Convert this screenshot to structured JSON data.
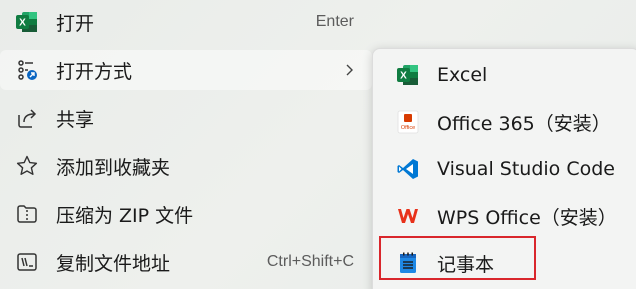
{
  "context_menu": {
    "items": [
      {
        "label": "打开",
        "shortcut": "Enter",
        "icon": "excel-icon"
      },
      {
        "label": "打开方式",
        "icon": "open-with-icon",
        "has_submenu": true
      },
      {
        "label": "共享",
        "icon": "share-icon"
      },
      {
        "label": "添加到收藏夹",
        "icon": "star-icon"
      },
      {
        "label": "压缩为 ZIP 文件",
        "icon": "zip-icon"
      },
      {
        "label": "复制文件地址",
        "shortcut": "Ctrl+Shift+C",
        "icon": "copy-path-icon"
      }
    ]
  },
  "open_with_submenu": {
    "items": [
      {
        "label": "Excel",
        "icon": "excel-icon"
      },
      {
        "label": "Office 365（安装）",
        "icon": "office-icon",
        "icon_text": "Office"
      },
      {
        "label": "Visual Studio Code",
        "icon": "vscode-icon"
      },
      {
        "label": "WPS Office（安装）",
        "icon": "wps-icon"
      },
      {
        "label": "记事本",
        "icon": "notepad-icon",
        "highlighted": true
      }
    ]
  },
  "colors": {
    "excel_green": "#1d6f42",
    "office_red": "#d83b01",
    "vscode_blue": "#0078d4",
    "wps_red": "#e8311a",
    "notepad_blue": "#1e88e5",
    "highlight_box": "#d9262c"
  }
}
